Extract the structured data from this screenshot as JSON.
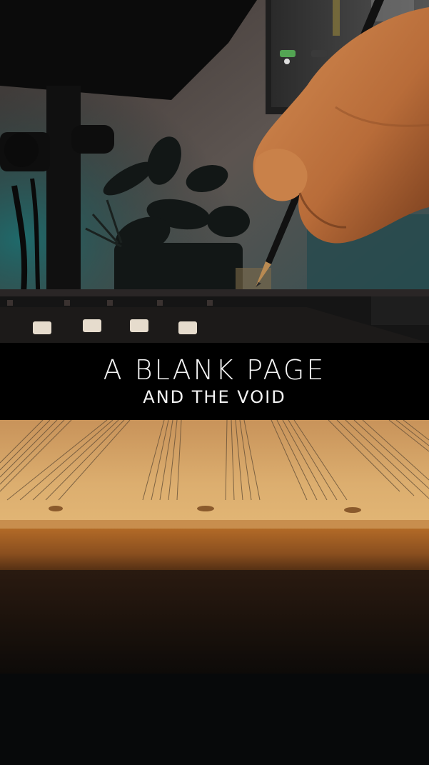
{
  "overlay": {
    "line1": "A BLANK PAGE",
    "line2": "AND THE VOID"
  },
  "colors": {
    "wall_teal": "#1f5a5c",
    "wall_gray": "#5b5553",
    "paper": "#d7a868",
    "desk": "#8a4f1f",
    "band": "#000000",
    "text": "#f4f4f4"
  }
}
